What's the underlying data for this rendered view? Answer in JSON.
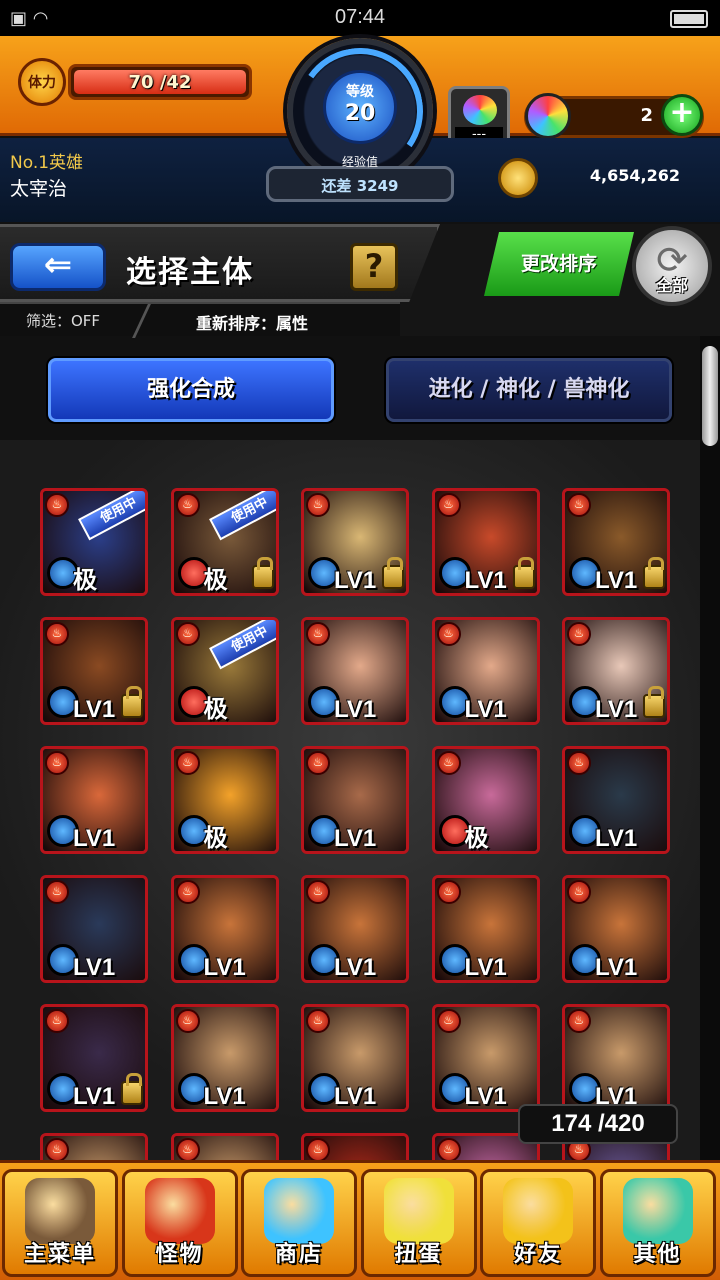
{
  "status_bar": {
    "time": "07:44"
  },
  "header": {
    "stamina_icon_label": "体力",
    "stamina_text": "70 /42",
    "stamina_fraction": 1.0,
    "level_label": "等级",
    "level_value": "20",
    "orb_slot_text": "---",
    "gems_count": "2",
    "gems_add": "+"
  },
  "profile": {
    "rank": "No.1英雄",
    "username": "太宰治",
    "exp_label": "经验值",
    "exp_value": "还差 3249",
    "coins": "4,654,262"
  },
  "titlebar": {
    "back_icon": "⇐",
    "title": "选择主体",
    "help": "?",
    "sort_button": "更改排序",
    "all_button": "全部",
    "filter_text": "筛选：OFF",
    "reorder_text": "重新排序：属性"
  },
  "modes": {
    "enhance": "强化合成",
    "evolve": "进化 / 神化 / 兽神化"
  },
  "monsters": [
    {
      "badge": "极",
      "in_use": "使用中",
      "lock": false,
      "fruit": false,
      "color": "#2b3f8a"
    },
    {
      "badge": "极",
      "in_use": "使用中",
      "lock": true,
      "fruit": true,
      "color": "#7a5a3a"
    },
    {
      "badge": "LV1",
      "in_use": "",
      "lock": true,
      "fruit": false,
      "color": "#d9b774"
    },
    {
      "badge": "LV1",
      "in_use": "",
      "lock": true,
      "fruit": false,
      "color": "#c84a2a"
    },
    {
      "badge": "LV1",
      "in_use": "",
      "lock": true,
      "fruit": false,
      "color": "#8a5a2a"
    },
    {
      "badge": "LV1",
      "in_use": "",
      "lock": true,
      "fruit": false,
      "color": "#8a4a22"
    },
    {
      "badge": "极",
      "in_use": "使用中",
      "lock": false,
      "fruit": true,
      "color": "#9a7a3a"
    },
    {
      "badge": "LV1",
      "in_use": "",
      "lock": false,
      "fruit": false,
      "color": "#e3a98a"
    },
    {
      "badge": "LV1",
      "in_use": "",
      "lock": false,
      "fruit": false,
      "color": "#e3a98a"
    },
    {
      "badge": "LV1",
      "in_use": "",
      "lock": true,
      "fruit": false,
      "color": "#e8c8b8"
    },
    {
      "badge": "LV1",
      "in_use": "",
      "lock": false,
      "fruit": false,
      "color": "#d9683a"
    },
    {
      "badge": "极",
      "in_use": "",
      "lock": false,
      "fruit": false,
      "color": "#f3a22a"
    },
    {
      "badge": "LV1",
      "in_use": "",
      "lock": false,
      "fruit": false,
      "color": "#a86a4a"
    },
    {
      "badge": "极",
      "in_use": "",
      "lock": false,
      "fruit": true,
      "color": "#c86a9a"
    },
    {
      "badge": "LV1",
      "in_use": "",
      "lock": false,
      "fruit": false,
      "color": "#2a3a4a"
    },
    {
      "badge": "LV1",
      "in_use": "",
      "lock": false,
      "fruit": false,
      "color": "#2a3a5a"
    },
    {
      "badge": "LV1",
      "in_use": "",
      "lock": false,
      "fruit": false,
      "color": "#c8743a"
    },
    {
      "badge": "LV1",
      "in_use": "",
      "lock": false,
      "fruit": false,
      "color": "#c8743a"
    },
    {
      "badge": "LV1",
      "in_use": "",
      "lock": false,
      "fruit": false,
      "color": "#c8743a"
    },
    {
      "badge": "LV1",
      "in_use": "",
      "lock": false,
      "fruit": false,
      "color": "#c8743a"
    },
    {
      "badge": "LV1",
      "in_use": "",
      "lock": true,
      "fruit": false,
      "color": "#3a2a4a"
    },
    {
      "badge": "LV1",
      "in_use": "",
      "lock": false,
      "fruit": false,
      "color": "#c89a6a"
    },
    {
      "badge": "LV1",
      "in_use": "",
      "lock": false,
      "fruit": false,
      "color": "#c89a6a"
    },
    {
      "badge": "LV1",
      "in_use": "",
      "lock": false,
      "fruit": false,
      "color": "#c89a6a"
    },
    {
      "badge": "LV1",
      "in_use": "",
      "lock": false,
      "fruit": false,
      "color": "#c89a6a"
    },
    {
      "badge": "",
      "in_use": "",
      "lock": false,
      "fruit": false,
      "color": "#c89a6a"
    },
    {
      "badge": "",
      "in_use": "",
      "lock": false,
      "fruit": false,
      "color": "#c89a6a"
    },
    {
      "badge": "",
      "in_use": "",
      "lock": false,
      "fruit": false,
      "color": "#b02a1a"
    },
    {
      "badge": "",
      "in_use": "",
      "lock": false,
      "fruit": false,
      "color": "#c86aa8"
    },
    {
      "badge": "",
      "in_use": "",
      "lock": false,
      "fruit": false,
      "color": "#6a5a9a"
    }
  ],
  "box_count": "174 /420",
  "bottom_nav": [
    {
      "label": "主菜单",
      "icon": "castle-icon",
      "color": "#7a5a3a"
    },
    {
      "label": "怪物",
      "icon": "monster-icon",
      "color": "#d8361a"
    },
    {
      "label": "商店",
      "icon": "orb-icon",
      "color": "#3ec3ff"
    },
    {
      "label": "扭蛋",
      "icon": "egg-icon",
      "color": "#f0e03a"
    },
    {
      "label": "好友",
      "icon": "friends-icon",
      "color": "#f3c21a"
    },
    {
      "label": "其他",
      "icon": "question-icon",
      "color": "#3ac8a8"
    }
  ]
}
